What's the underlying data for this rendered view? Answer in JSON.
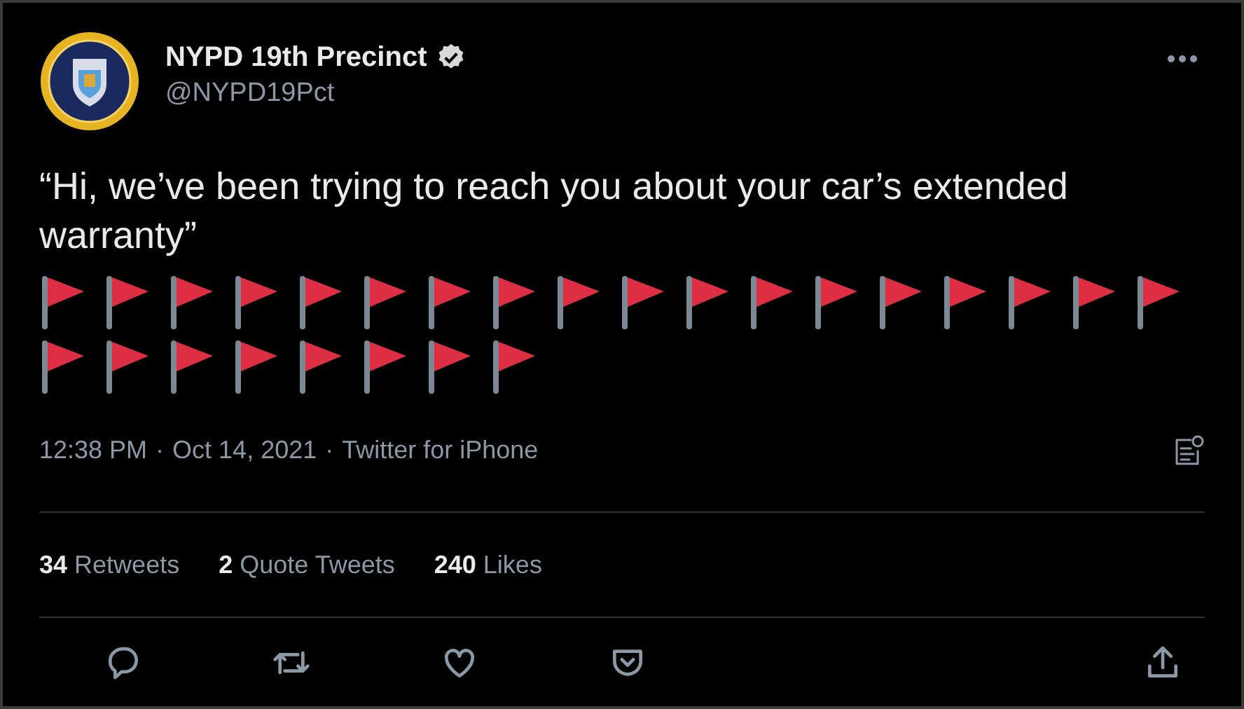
{
  "author": {
    "name": "NYPD 19th Precinct",
    "verified": true,
    "handle": "@NYPD19Pct"
  },
  "tweet": {
    "text": "“Hi, we’ve been trying to reach you about your car’s extended warranty”",
    "emoji": [
      {
        "kind": "flag"
      },
      {
        "kind": "flag"
      },
      {
        "kind": "flag"
      },
      {
        "kind": "flag"
      },
      {
        "kind": "flag"
      },
      {
        "kind": "flag"
      },
      {
        "kind": "flag"
      },
      {
        "kind": "flag"
      },
      {
        "kind": "flag"
      },
      {
        "kind": "flag"
      },
      {
        "kind": "flag"
      },
      {
        "kind": "flag"
      },
      {
        "kind": "flag"
      },
      {
        "kind": "flag"
      },
      {
        "kind": "flag"
      },
      {
        "kind": "flag"
      },
      {
        "kind": "flag"
      },
      {
        "kind": "flag"
      },
      {
        "kind": "flag"
      },
      {
        "kind": "flag"
      },
      {
        "kind": "flag"
      },
      {
        "kind": "flag"
      },
      {
        "kind": "flag"
      },
      {
        "kind": "flag"
      },
      {
        "kind": "flag"
      },
      {
        "kind": "flag"
      }
    ],
    "time": "12:38 PM",
    "separator": "·",
    "date": "Oct 14, 2021",
    "source": "Twitter for iPhone"
  },
  "stats": [
    {
      "count": "34",
      "label": "Retweets"
    },
    {
      "count": "2",
      "label": "Quote Tweets"
    },
    {
      "count": "240",
      "label": "Likes"
    }
  ],
  "actions": [
    {
      "kind": "reply"
    },
    {
      "kind": "retweet"
    },
    {
      "kind": "like"
    },
    {
      "kind": "save"
    },
    {
      "kind": "share"
    }
  ]
}
